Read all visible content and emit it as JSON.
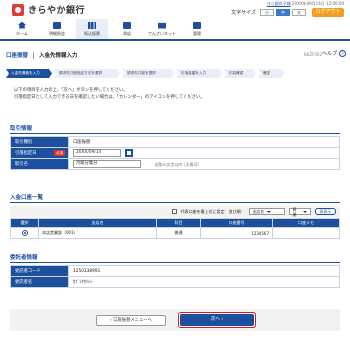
{
  "header": {
    "bank_name": "きらやか銀行",
    "user_name": "きら銀花子様",
    "last_login": "20XX年09月14日 12:00:00",
    "text_size_label": "文字サイズ",
    "size_small": "小",
    "size_medium": "中",
    "size_large": "大",
    "logout": "ログアウト"
  },
  "nav": [
    {
      "label": "ホーム"
    },
    {
      "label": "明細照会"
    },
    {
      "label": "振込振替"
    },
    {
      "label": "承認"
    },
    {
      "label": "でんさいネット"
    },
    {
      "label": "管理"
    }
  ],
  "title": {
    "category": "口座振替",
    "main": "入金先情報入力",
    "code": "BKZF002",
    "help": "ヘルプ",
    "help_icon": "?"
  },
  "steps": [
    "入金先情報を入力",
    "請求先口座指定方法を選択",
    "請求先口座を選択",
    "引落金額を入力",
    "内容確認",
    "確定"
  ],
  "instructions": [
    "以下の項目を入力の上、「次へ」ボタンを押してください。",
    "引落指定日として入力できる日を確認したい場合は、「カレンダー」のアイコンを押してください。"
  ],
  "torihiki": {
    "section_title": "取引情報",
    "rows": [
      {
        "label": "取引種別",
        "value": "口座振替"
      },
      {
        "label": "引落指定日",
        "required": "必須",
        "value": "20XX/09/14",
        "icon": "calendar-icon"
      },
      {
        "label": "取引名",
        "value": "月賦分集分",
        "hint": "全角10文字以内［半角可］"
      }
    ]
  },
  "nyukin": {
    "section_title": "入金口座一覧",
    "filter_checkbox": "代表口座を最上位に設定",
    "sort_label": "並び順：",
    "sort_value": "支店名",
    "order_value": "昇順",
    "display_button": "再表示",
    "columns": [
      "選択",
      "支店名",
      "科目",
      "口座番号",
      "口座メモ"
    ],
    "rows": [
      {
        "branch": "本店営業部（001）",
        "subject": "普通",
        "number": "1234567",
        "memo": ""
      }
    ]
  },
  "itaku": {
    "section_title": "委託者情報",
    "rows": [
      {
        "label": "委託者コード",
        "value": "1250338991"
      },
      {
        "label": "委託者名",
        "value": "ｶﾌﾞｼｷｶｲｼｬ"
      }
    ]
  },
  "buttons": {
    "back": "口座振替メニューへ",
    "next": "次へ"
  },
  "colors": {
    "primary": "#1c4f9c",
    "accent_red": "#d41e2a",
    "logout_orange": "#f0a020"
  }
}
